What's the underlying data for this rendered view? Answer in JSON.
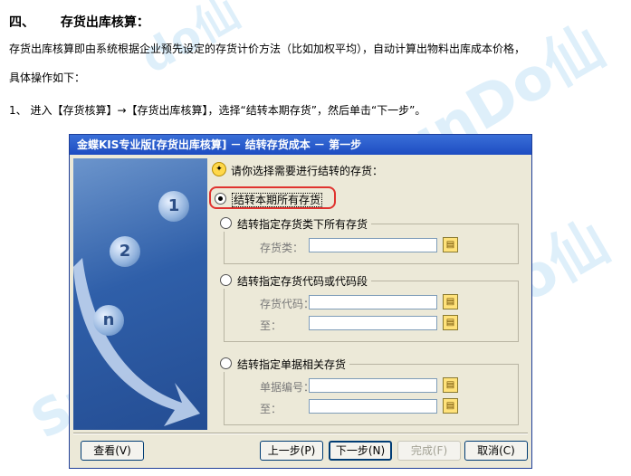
{
  "doc": {
    "heading_num": "四、",
    "heading_text": "存货出库核算：",
    "para1": "存货出库核算即由系统根据企业预先设定的存货计价方法（比如加权平均），自动计算出物料出库成本价格，",
    "para2": "具体操作如下：",
    "para3": "1、 进入【存货核算】→【存货出库核算】，选择“结转本期存货”，然后单击“下一步”。"
  },
  "watermarks": [
    "SunDo仙",
    "do仙",
    "SunDo仙",
    "do仙"
  ],
  "dialog": {
    "title": "金蝶KIS专业版[存货出库核算] － 结转存货成本 － 第一步",
    "hint": "请你选择需要进行结转的存货：",
    "side_numbers": [
      "1",
      "2",
      "n"
    ],
    "options": [
      {
        "label": "结转本期所有存货",
        "selected": true
      },
      {
        "label": "结转指定存货类下所有存货",
        "selected": false
      },
      {
        "label": "结转指定存货代码或代码段",
        "selected": false
      },
      {
        "label": "结转指定单据相关存货",
        "selected": false
      }
    ],
    "fields": {
      "category_label": "存货类：",
      "code_label": "存货代码：",
      "code_to_label": "至：",
      "doc_label": "单据编号：",
      "doc_to_label": "至："
    },
    "buttons": {
      "view": "查看(V)",
      "prev": "上一步(P)",
      "next": "下一步(N)",
      "finish": "完成(F)",
      "cancel": "取消(C)"
    }
  }
}
